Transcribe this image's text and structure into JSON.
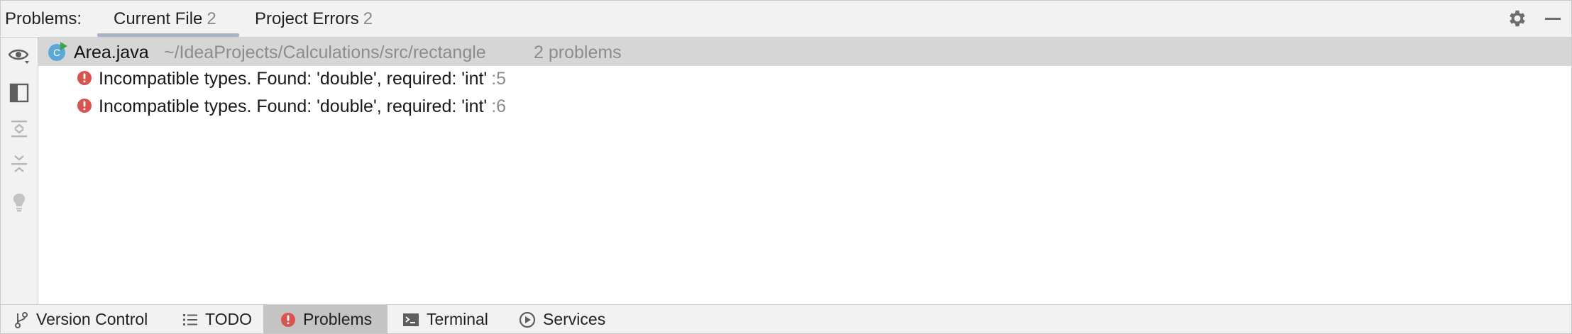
{
  "header": {
    "title": "Problems:",
    "tabs": [
      {
        "label": "Current File",
        "count": "2"
      },
      {
        "label": "Project Errors",
        "count": "2"
      }
    ],
    "settings_icon": "gear-icon",
    "minimize_icon": "minimize-icon"
  },
  "left_toolbar": {
    "icons": [
      "eye-icon",
      "preview-panel-icon",
      "expand-all-icon",
      "collapse-all-icon",
      "lightbulb-icon"
    ]
  },
  "tree": {
    "file": {
      "icon": "java-class-icon",
      "icon_letter": "C",
      "name": "Area.java",
      "path": "~/IdeaProjects/Calculations/src/rectangle",
      "problem_count": "2 problems"
    },
    "problems": [
      {
        "message": "Incompatible types. Found: 'double', required: 'int'",
        "line": ":5",
        "icon": "error-icon"
      },
      {
        "message": "Incompatible types. Found: 'double', required: 'int'",
        "line": ":6",
        "icon": "error-icon"
      }
    ]
  },
  "bottom_bar": {
    "items": [
      {
        "label": "Version Control",
        "icon": "branch-icon"
      },
      {
        "label": "TODO",
        "icon": "list-icon"
      },
      {
        "label": "Problems",
        "icon": "error-icon"
      },
      {
        "label": "Terminal",
        "icon": "terminal-icon"
      },
      {
        "label": "Services",
        "icon": "services-icon"
      }
    ]
  },
  "colors": {
    "error": "#d9534f",
    "java_class_icon": "#5aa8d6",
    "java_run_marker": "#3fa34d",
    "selected_row": "#d6d6d6",
    "muted_text": "#8c8c8c"
  }
}
